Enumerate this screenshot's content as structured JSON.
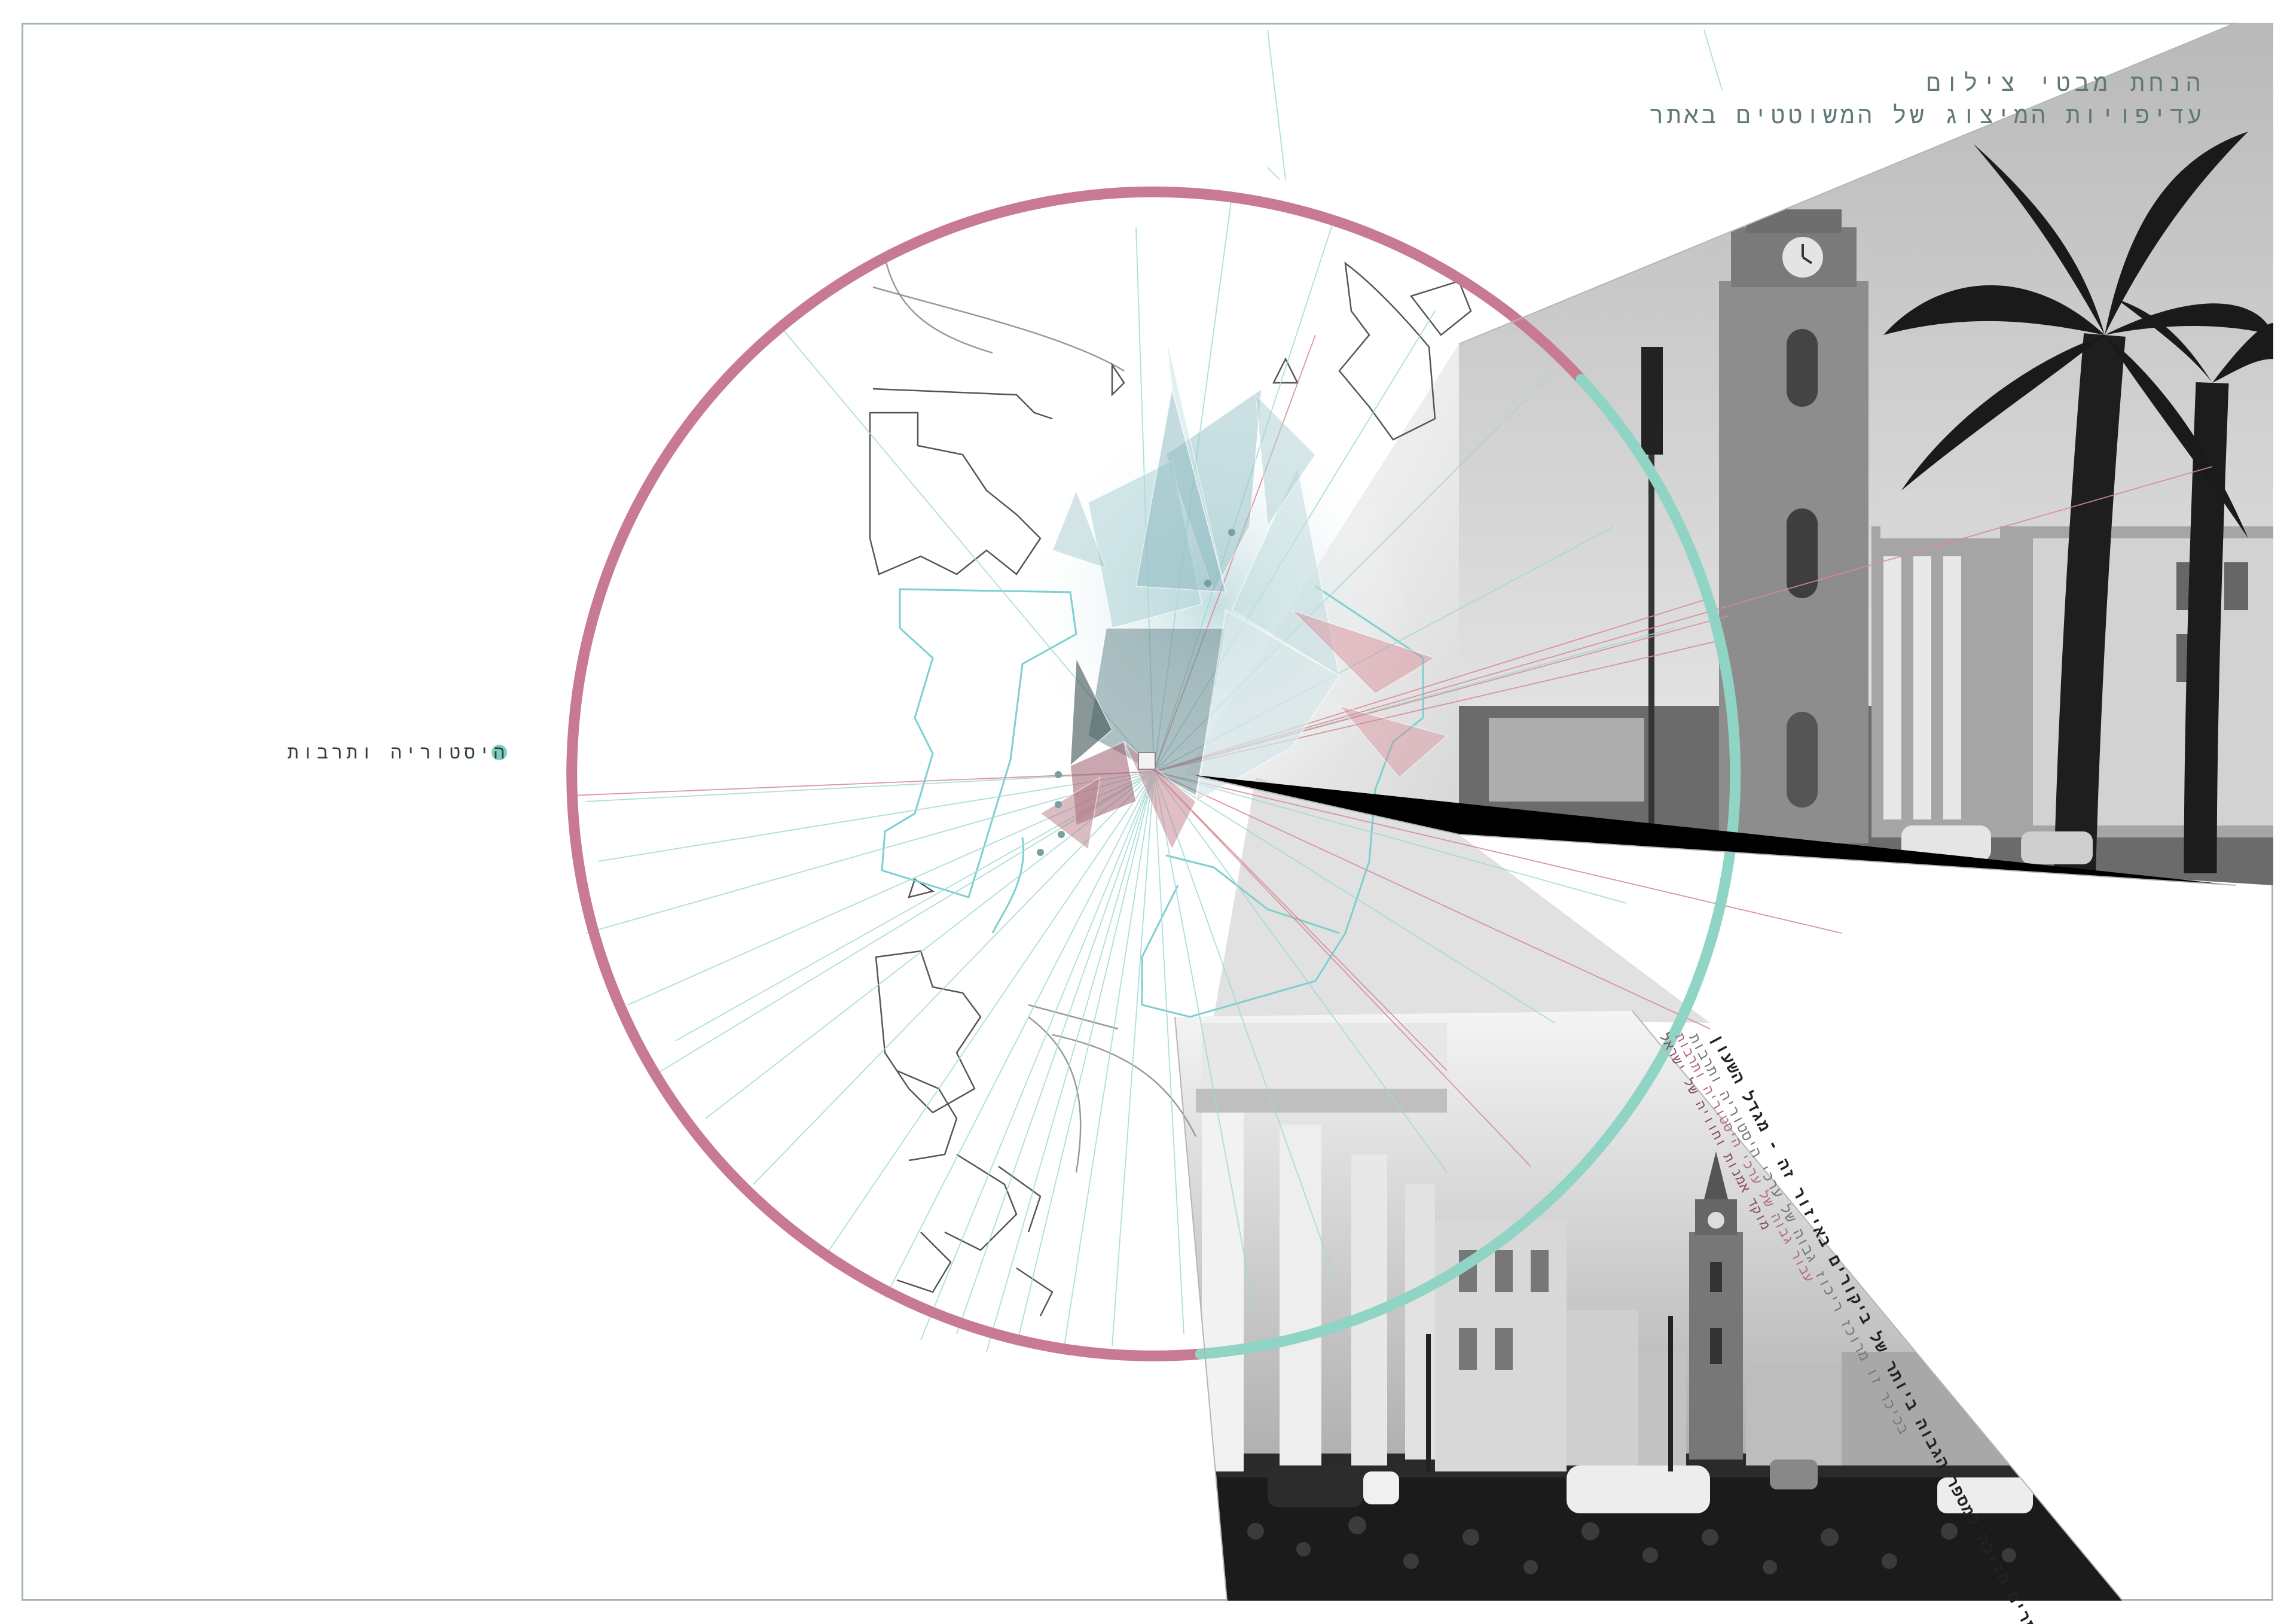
{
  "header": {
    "title_line1": "הנחת מבטי צילום",
    "title_line2": "עדיפויות המיצוג של המשוטטים באתר"
  },
  "category": {
    "label": "היסטוריה ותרבות",
    "color": "#7fcfc0"
  },
  "caption": {
    "line1": "אחד האתרים הזוכה למספר הגבוה ביותר של ביקורים באיזור זה - מגדל השעון",
    "line2": "בכיכר זו מרוכז ריכוז גבוה של ערכי היסטוריה ותרבות",
    "line3": "עבור גבוה של ערכי היסטוריה ותרבות",
    "line4": "מוקד אמנות וחוויה של ישראל"
  },
  "colors": {
    "circle_pink": "#c97a93",
    "circle_teal": "#8fd4c4",
    "frame": "#9fb3b3",
    "plan_lines": "#8fd0cf",
    "view_lines_red": "#d98a95"
  }
}
